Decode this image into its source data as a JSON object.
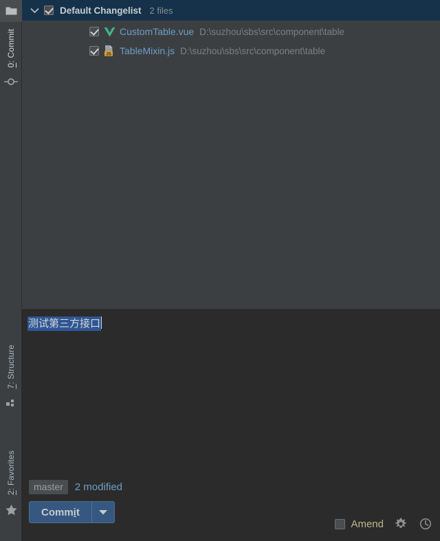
{
  "toolstrip": {
    "folder_icon": "folder-icon",
    "tabs": [
      {
        "label_prefix": "0",
        "label": ": Commit",
        "icon": "commit-node-icon",
        "active": true
      },
      {
        "label_prefix": "7",
        "label": ": Structure",
        "icon": "structure-icon",
        "active": false
      },
      {
        "label_prefix": "2",
        "label": ": Favorites",
        "icon": "star-icon",
        "active": false
      }
    ]
  },
  "changelist": {
    "expand_icon": "chevron-down-icon",
    "checked": true,
    "title": "Default Changelist",
    "count": "2 files",
    "files": [
      {
        "checked": true,
        "icon": "vue-file-icon",
        "name": "CustomTable.vue",
        "path": "D:\\suzhou\\sbs\\src\\component\\table"
      },
      {
        "checked": true,
        "icon": "js-file-icon",
        "name": "TableMixin.js",
        "path": "D:\\suzhou\\sbs\\src\\component\\table"
      }
    ]
  },
  "message": {
    "value": "测试第三方接口",
    "selected": true
  },
  "footer": {
    "branch": "master",
    "modified": "2 modified",
    "commit_label_a": "Comm",
    "commit_label_mnemonic": "i",
    "commit_label_b": "t",
    "commit_dropdown_icon": "chevron-down-icon",
    "amend_label": "Amend",
    "amend_checked": false,
    "settings_icon": "gear-icon",
    "history_icon": "clock-icon"
  },
  "colors": {
    "header_bg": "#15324a",
    "panel_bg": "#3c3f41",
    "editor_bg": "#2b2b2b",
    "accent_blue": "#6c9ec9",
    "button_blue": "#365880",
    "selection_blue": "#2f5695",
    "vue_green": "#41b883",
    "js_orange": "#d6a038"
  }
}
